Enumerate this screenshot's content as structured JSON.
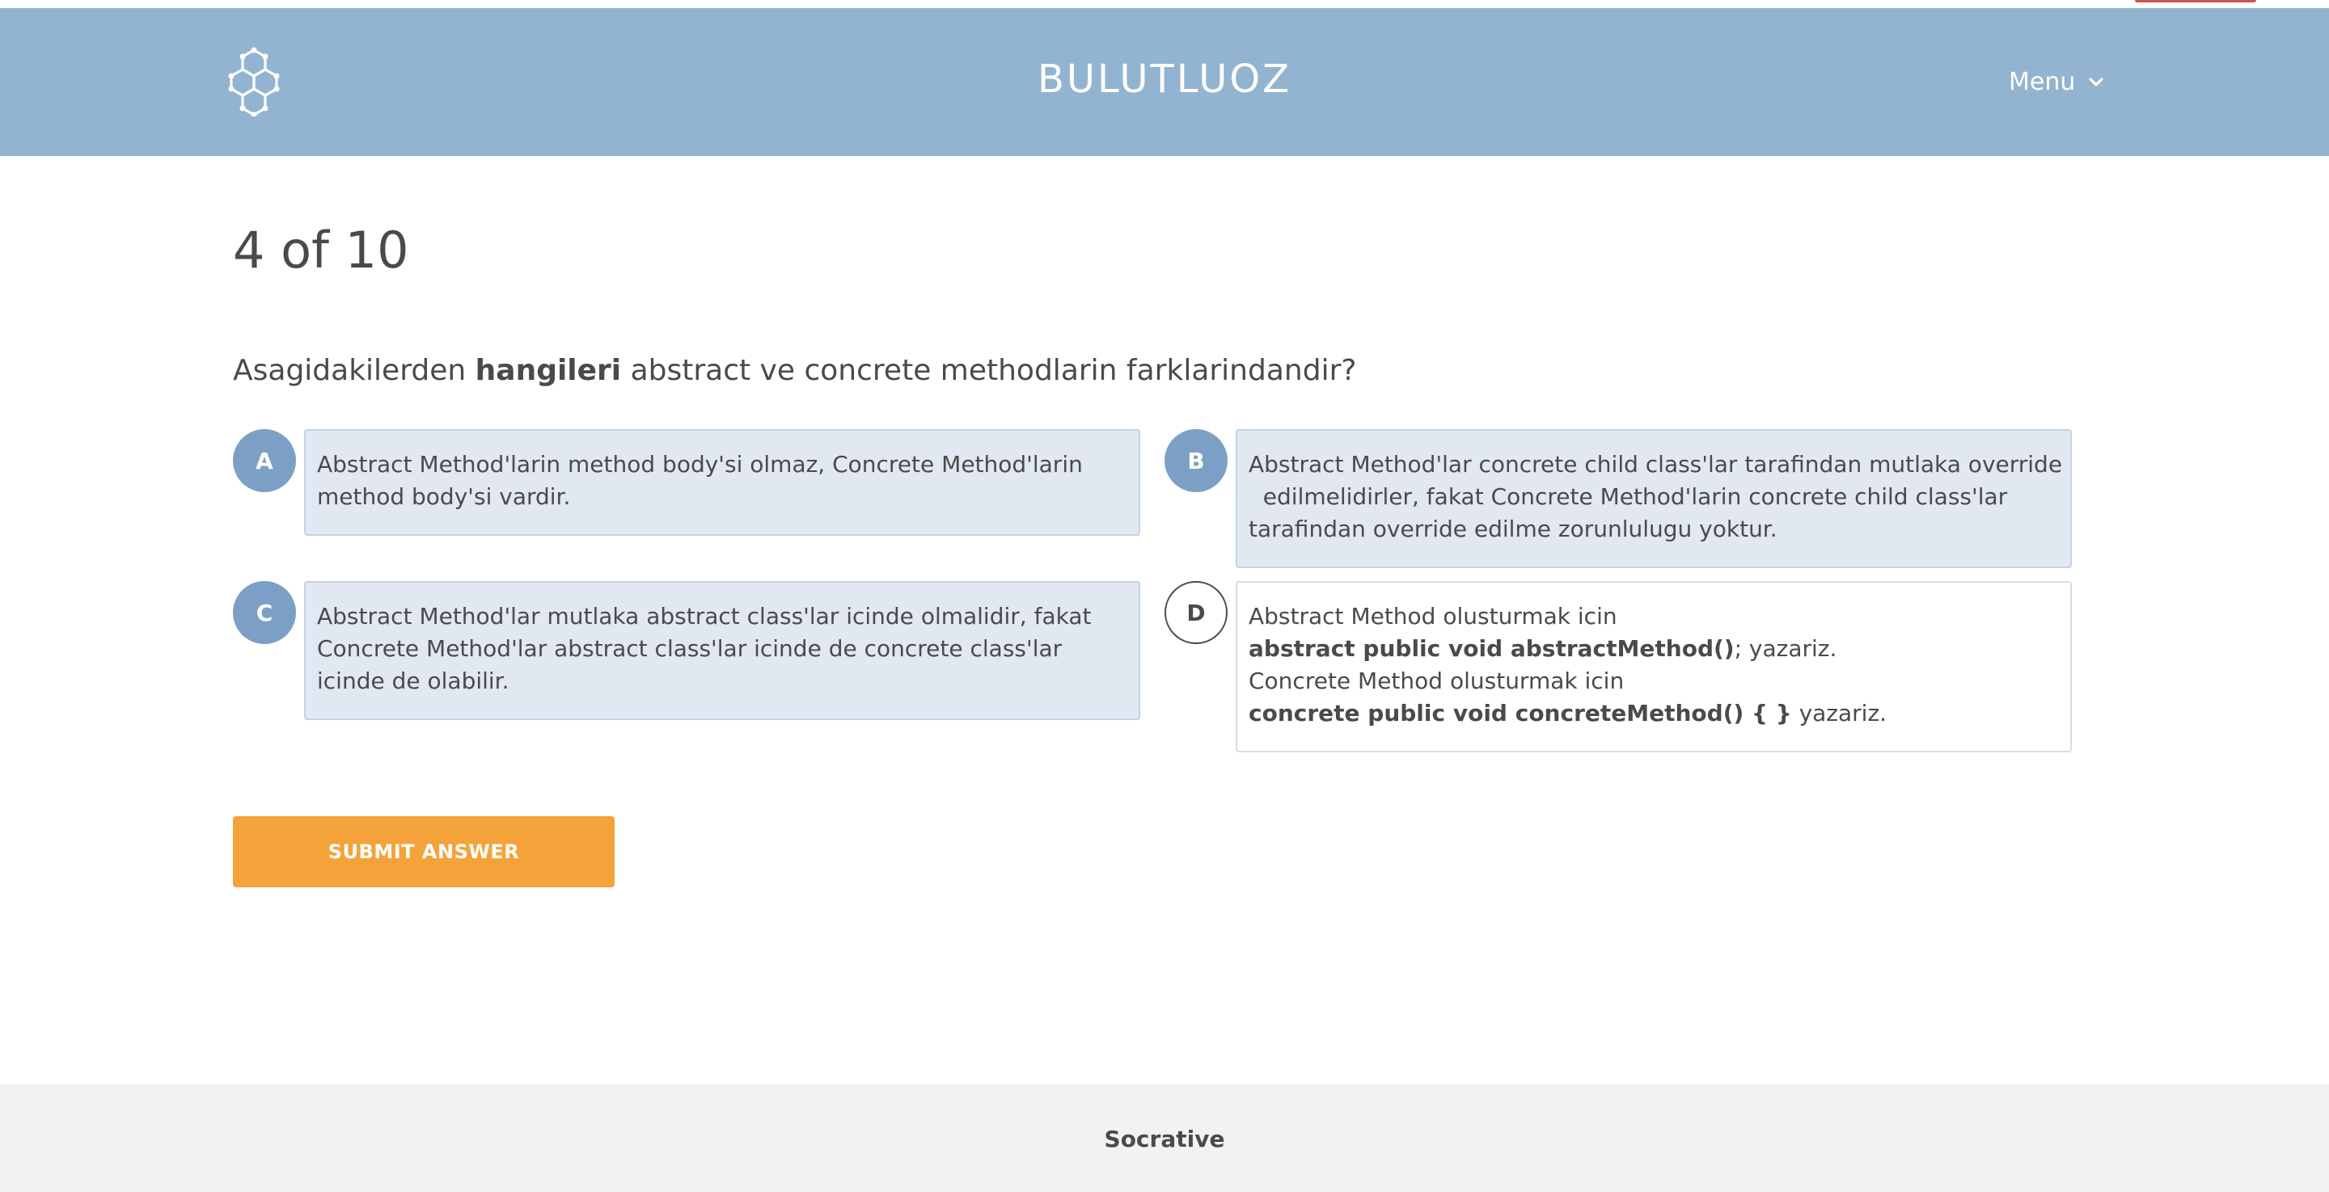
{
  "header": {
    "brand": "BULUTLUOZ",
    "menu_label": "Menu",
    "logo_icon": "hexagon-cluster-logo-icon",
    "menu_icon": "chevron-down-icon",
    "bg_color": "#92b4d0"
  },
  "quiz": {
    "progress": "4 of 10",
    "question": {
      "prefix": "Asagidakilerden ",
      "bold": "hangileri",
      "suffix": " abstract ve concrete methodlarin farklarindandir?"
    },
    "answers": [
      {
        "letter": "A",
        "selected": true,
        "text": "Abstract Method'larin method body'si olmaz, Concrete Method'larin method body'si vardir."
      },
      {
        "letter": "B",
        "selected": true,
        "text_line1": "Abstract Method'lar concrete child class'lar tarafindan mutlaka override",
        "text_line2": "  edilmelidirler, fakat Concrete Method'larin concrete child class'lar",
        "text_line3": "tarafindan override edilme zorunlulugu yoktur."
      },
      {
        "letter": "C",
        "selected": true,
        "text": "Abstract Method'lar mutlaka abstract class'lar icinde olmalidir, fakat Concrete Method'lar abstract class'lar icinde de concrete class'lar icinde de olabilir."
      },
      {
        "letter": "D",
        "selected": false,
        "line1": "Abstract Method olusturmak icin",
        "line2_bold": "abstract public void abstractMethod()",
        "line2_rest": "; yazariz.",
        "line3": "Concrete Method olusturmak icin",
        "line4_bold": "concrete public void concreteMethod() { }",
        "line4_rest": " yazariz."
      }
    ],
    "submit_label": "SUBMIT ANSWER",
    "accent_color": "#f4a33b",
    "selected_color": "#7ca0c5"
  },
  "footer": {
    "text": "Socrative"
  }
}
